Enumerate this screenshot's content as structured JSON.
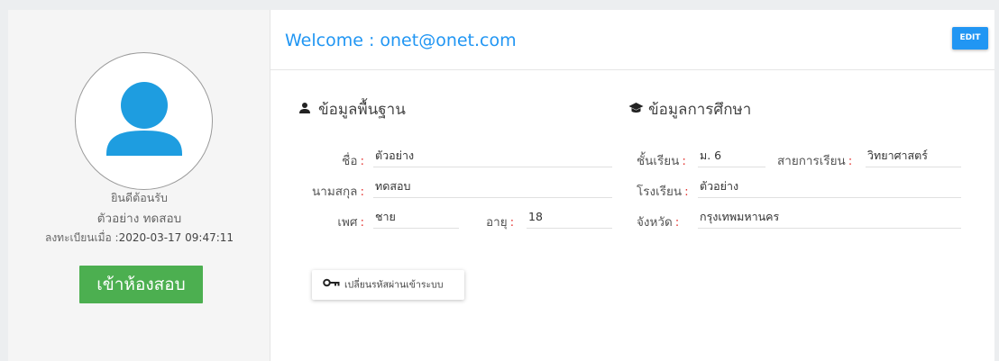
{
  "profile": {
    "greeting": "ยินดีต้อนรับ",
    "name": "ตัวอย่าง ทดสอบ",
    "registered_label": "ลงทะเบียนเมื่อ :",
    "registered_at": "2020-03-17 09:47:11",
    "enter_button": "เข้าห้องสอบ"
  },
  "header": {
    "title": "Welcome : onet@onet.com",
    "edit_button": "EDIT"
  },
  "basic_info": {
    "title": "ข้อมูลพื้นฐาน",
    "first_name_label": "ชื่อ",
    "first_name": "ตัวอย่าง",
    "last_name_label": "นามสกุล",
    "last_name": "ทดสอบ",
    "gender_label": "เพศ",
    "gender": "ชาย",
    "age_label": "อายุ",
    "age": "18"
  },
  "education_info": {
    "title": "ข้อมูลการศึกษา",
    "grade_label": "ชั้นเรียน",
    "grade": "ม. 6",
    "program_label": "สายการเรียน",
    "program": "วิทยาศาสตร์",
    "school_label": "โรงเรียน",
    "school": "ตัวอย่าง",
    "province_label": "จังหวัด",
    "province": "กรุงเทพมหานคร"
  },
  "change_password_button": "เปลี่ยนรหัสผ่านเข้าระบบ",
  "colors": {
    "accent": "#2196f3",
    "enter_button": "#4caf50",
    "colon": "#e53935",
    "avatar": "#1e9de0"
  },
  "icons": {
    "avatar": "user-avatar-icon",
    "basic_info": "person-icon",
    "education_info": "graduation-cap-icon",
    "change_password": "key-icon"
  }
}
